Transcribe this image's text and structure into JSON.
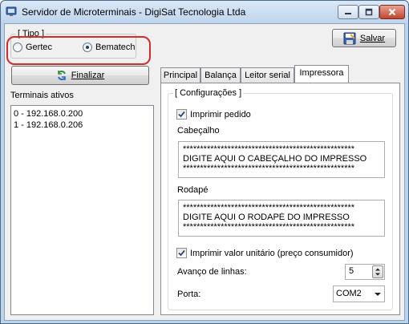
{
  "window": {
    "title": "Servidor de Microterminais - DigiSat Tecnologia Ltda"
  },
  "tipo": {
    "group_label": "[ Tipo ]",
    "options": [
      {
        "label": "Gertec",
        "selected": false
      },
      {
        "label": "Bematech",
        "selected": true
      }
    ]
  },
  "toolbar": {
    "finalizar_label": "Finalizar",
    "salvar_label": "Salvar"
  },
  "terminais": {
    "label": "Terminais ativos",
    "items": [
      "0 - 192.168.0.200",
      "1 - 192.168.0.206"
    ]
  },
  "tabs": [
    {
      "label": "Principal",
      "active": false
    },
    {
      "label": "Balança",
      "active": false
    },
    {
      "label": "Leitor serial",
      "active": false
    },
    {
      "label": "Impressora",
      "active": true
    }
  ],
  "impressora": {
    "group_label": "[ Configurações ]",
    "imprimir_pedido": {
      "label": "Imprimir pedido",
      "checked": true
    },
    "cabecalho": {
      "label": "Cabeçalho",
      "lines": [
        "**************************************************",
        "DIGITE AQUI O CABEÇALHO DO IMPRESSO",
        "**************************************************"
      ]
    },
    "rodape": {
      "label": "Rodapé",
      "lines": [
        "**************************************************",
        "DIGITE AQUI O RODAPÉ DO IMPRESSO",
        "**************************************************"
      ]
    },
    "imprimir_valor": {
      "label": "Imprimir valor unitário (preço consumidor)",
      "checked": true
    },
    "avanco": {
      "label": "Avanço de linhas:",
      "value": "5"
    },
    "porta": {
      "label": "Porta:",
      "value": "COM2"
    }
  },
  "colors": {
    "highlight": "#d42b2b",
    "titlebar": "#bfd4ec",
    "close": "#c0462e"
  }
}
